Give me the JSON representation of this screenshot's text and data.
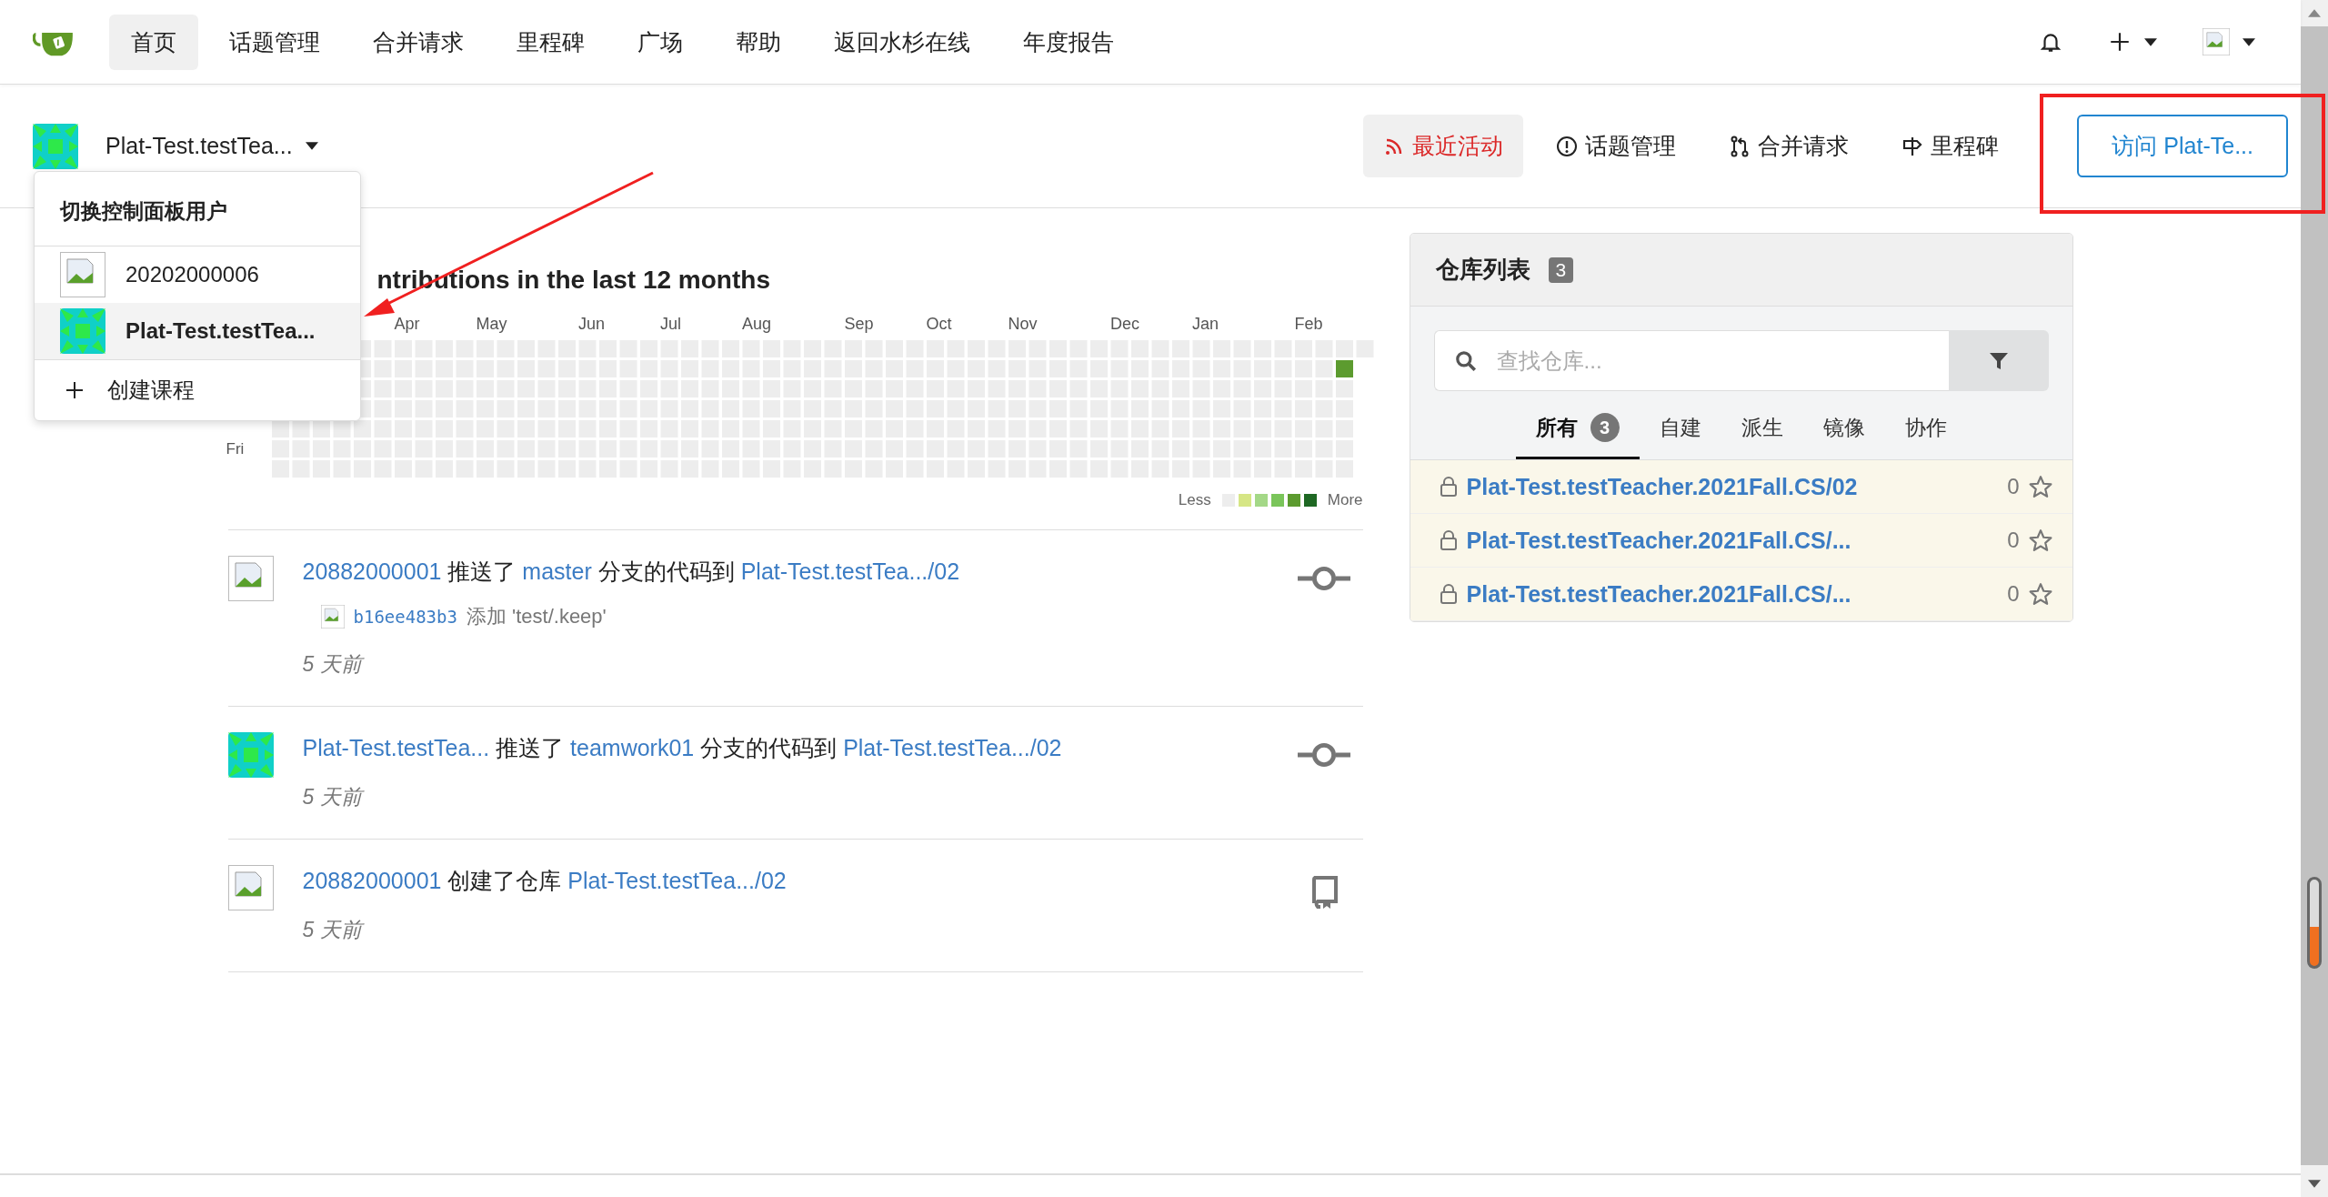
{
  "nav": {
    "items": [
      {
        "label": "首页",
        "selected": true
      },
      {
        "label": "话题管理",
        "selected": false
      },
      {
        "label": "合并请求",
        "selected": false
      },
      {
        "label": "里程碑",
        "selected": false
      },
      {
        "label": "广场",
        "selected": false
      },
      {
        "label": "帮助",
        "selected": false
      },
      {
        "label": "返回水杉在线",
        "selected": false
      },
      {
        "label": "年度报告",
        "selected": false
      }
    ]
  },
  "context": {
    "name": "Plat-Test.testTea...",
    "tabs": [
      {
        "label": "最近活动",
        "kind": "activity",
        "selected": true
      },
      {
        "label": "话题管理",
        "kind": "issues",
        "selected": false
      },
      {
        "label": "合并请求",
        "kind": "pulls",
        "selected": false
      },
      {
        "label": "里程碑",
        "kind": "milestones",
        "selected": false
      }
    ],
    "visit_button": "访问 Plat-Te..."
  },
  "switcher": {
    "title": "切换控制面板用户",
    "users": [
      {
        "name": "20202000006",
        "kind": "broken",
        "selected": false
      },
      {
        "name": "Plat-Test.testTea...",
        "kind": "pattern",
        "selected": true
      }
    ],
    "create": "创建课程"
  },
  "heatmap": {
    "title": "ntributions in the last 12 months",
    "months": [
      "Apr",
      "May",
      "Jun",
      "Jul",
      "Aug",
      "Sep",
      "Oct",
      "Nov",
      "Dec",
      "Jan",
      "Feb"
    ],
    "weekdays": [
      "Fri"
    ],
    "less": "Less",
    "more": "More"
  },
  "feed": [
    {
      "kind": "push",
      "actor": {
        "kind": "broken"
      },
      "parts": [
        {
          "kind": "link",
          "text": "20882000001"
        },
        {
          "kind": "text",
          "text": "推送了"
        },
        {
          "kind": "link",
          "text": "master"
        },
        {
          "kind": "text",
          "text": "分支的代码到"
        },
        {
          "kind": "link",
          "text": "Plat-Test.testTea.../02"
        }
      ],
      "commits": [
        {
          "sha": "b16ee483b3",
          "message": "添加 'test/.keep'"
        }
      ],
      "time": "5 天前"
    },
    {
      "kind": "push",
      "actor": {
        "kind": "pattern"
      },
      "parts": [
        {
          "kind": "link",
          "text": "Plat-Test.testTea..."
        },
        {
          "kind": "text",
          "text": "推送了"
        },
        {
          "kind": "link",
          "text": "teamwork01"
        },
        {
          "kind": "text",
          "text": "分支的代码到"
        },
        {
          "kind": "link",
          "text": "Plat-Test.testTea.../02"
        }
      ],
      "time": "5 天前"
    },
    {
      "kind": "create",
      "actor": {
        "kind": "broken"
      },
      "parts": [
        {
          "kind": "link",
          "text": "20882000001"
        },
        {
          "kind": "text",
          "text": "创建了仓库"
        },
        {
          "kind": "link",
          "text": "Plat-Test.testTea.../02"
        }
      ],
      "time": "5 天前"
    }
  ],
  "repos": {
    "title": "仓库列表",
    "count": "3",
    "search_placeholder": "查找仓库...",
    "tabs": [
      {
        "label": "所有",
        "count": "3",
        "selected": true
      },
      {
        "label": "自建",
        "selected": false
      },
      {
        "label": "派生",
        "selected": false
      },
      {
        "label": "镜像",
        "selected": false
      },
      {
        "label": "协作",
        "selected": false
      }
    ],
    "items": [
      {
        "name": "Plat-Test.testTeacher.2021Fall.CS/02",
        "private": true,
        "stars": "0"
      },
      {
        "name": "Plat-Test.testTeacher.2021Fall.CS/...",
        "private": true,
        "stars": "0"
      },
      {
        "name": "Plat-Test.testTeacher.2021Fall.CS/...",
        "private": true,
        "stars": "0"
      }
    ]
  }
}
